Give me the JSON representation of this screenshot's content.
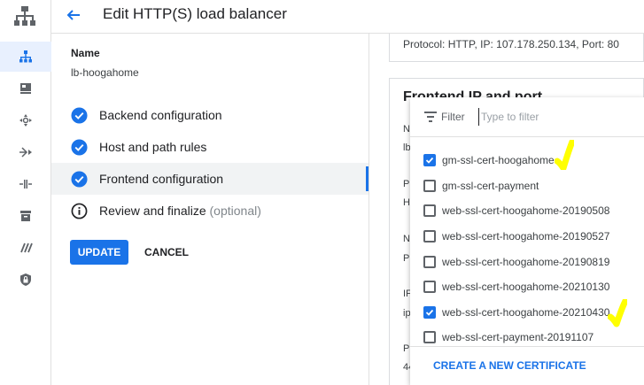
{
  "header": {
    "title": "Edit HTTP(S) load balancer"
  },
  "rail": {
    "icons": [
      "network-topology-icon",
      "compute-icon",
      "move-arrows-icon",
      "routing-icon",
      "connection-icon",
      "storage-box-icon",
      "slashes-icon",
      "security-shield-icon"
    ]
  },
  "left_panel": {
    "name_label": "Name",
    "name_value": "lb-hoogahome",
    "steps": [
      {
        "label": "Backend configuration",
        "status": "complete"
      },
      {
        "label": "Host and path rules",
        "status": "complete"
      },
      {
        "label": "Frontend configuration",
        "status": "complete"
      },
      {
        "label": "Review and finalize",
        "optional": "(optional)",
        "status": "info"
      }
    ],
    "update_label": "UPDATE",
    "cancel_label": "CANCEL"
  },
  "right_panel": {
    "protocol_line": "Protocol: HTTP, IP: 107.178.250.134, Port: 80",
    "frontend_title": "Frontend IP and port",
    "fragments": [
      "N",
      "lb",
      "P",
      "H",
      "N",
      "P",
      "IF",
      "ip",
      "P",
      "44"
    ]
  },
  "cert_dropdown": {
    "filter_label": "Filter",
    "filter_placeholder": "Type to filter",
    "options": [
      {
        "label": "gm-ssl-cert-hoogahome",
        "checked": true
      },
      {
        "label": "gm-ssl-cert-payment",
        "checked": false
      },
      {
        "label": "web-ssl-cert-hoogahome-20190508",
        "checked": false
      },
      {
        "label": "web-ssl-cert-hoogahome-20190527",
        "checked": false
      },
      {
        "label": "web-ssl-cert-hoogahome-20190819",
        "checked": false
      },
      {
        "label": "web-ssl-cert-hoogahome-20210130",
        "checked": false
      },
      {
        "label": "web-ssl-cert-hoogahome-20210430",
        "checked": true
      },
      {
        "label": "web-ssl-cert-payment-20191107",
        "checked": false
      }
    ],
    "create_label": "CREATE A NEW CERTIFICATE"
  },
  "colors": {
    "accent": "#1a73e8",
    "highlight_mark": "#ffff00"
  }
}
